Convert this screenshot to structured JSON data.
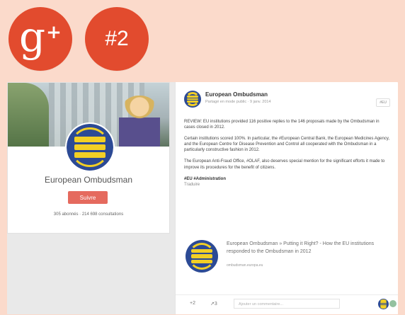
{
  "badges": {
    "gplus_logo": "g+",
    "number": "#2"
  },
  "profile": {
    "name": "European Ombudsman",
    "follow_button": "Suivre",
    "stats": "305 abonnés · 214 698 consultations"
  },
  "post": {
    "author": "European Ombudsman",
    "meta": "Partagé en mode public · 9 janv. 2014",
    "chip": "#EU",
    "body": [
      "REVIEW: EU institutions provided 116 positive replies to the 146 proposals made by the Ombudsman in cases closed in 2012.",
      "Certain institutions scored 100%. In particular, the #European Central Bank, the European Medicines Agency, and the European Centre for Disease Prevention and Control all cooperated with the Ombudsman in a particularly constructive fashion in 2012.",
      "The European Anti-Fraud Office, #OLAF, also deserves special mention for the significant efforts it made to improve its procedures for the benefit of citizens."
    ],
    "hashtag": "#EU #Administration",
    "translate": "Traduire",
    "link_title": "European Ombudsman » Putting it Right? - How the EU institutions responded to the Ombudsman in 2012",
    "link_domain": "ombudsman.europa.eu",
    "actions": {
      "plus": "+2",
      "share": "↗3",
      "comment_placeholder": "Ajouter un commentaire..."
    }
  },
  "colors": {
    "background": "#fbdacb",
    "accent_red": "#e24b2e",
    "logo_blue": "#2c4a95",
    "logo_yellow": "#f2cf25"
  },
  "icons": [
    "google-plus-icon",
    "hash-number-icon",
    "european-ombudsman-logo-icon",
    "share-icon"
  ]
}
